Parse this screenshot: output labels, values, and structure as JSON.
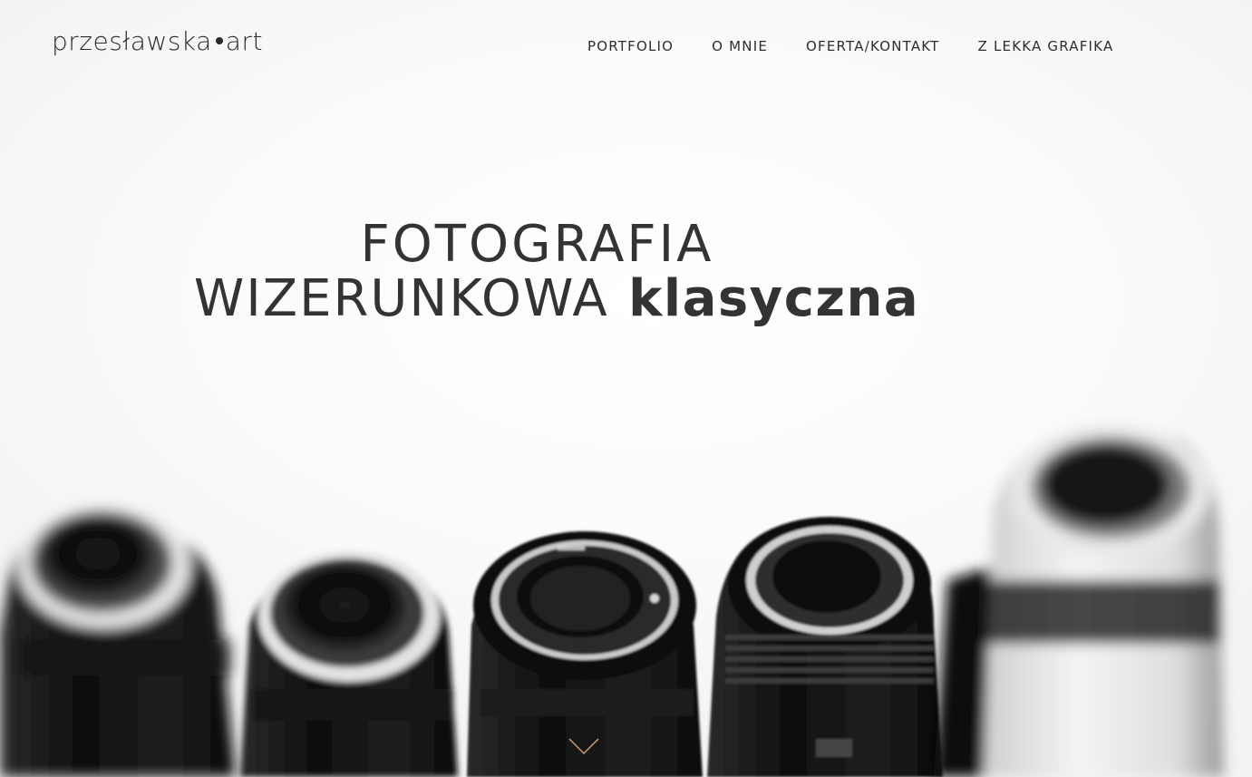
{
  "brand": {
    "logo_left": "przesławska",
    "logo_right": "art"
  },
  "nav": {
    "items": [
      {
        "label": "PORTFOLIO"
      },
      {
        "label": "O MNIE"
      },
      {
        "label": "OFERTA/KONTAKT"
      },
      {
        "label": "Z LEKKA GRAFIKA"
      }
    ]
  },
  "hero": {
    "line1": "FOTOGRAFIA",
    "line2_normal": "WIZERUNKOWA",
    "line2_bold": "klasyczna"
  },
  "colors": {
    "text": "#333333",
    "accent": "#b9926a",
    "background": "#ffffff"
  },
  "icons": {
    "scroll": "chevron-down-icon"
  }
}
